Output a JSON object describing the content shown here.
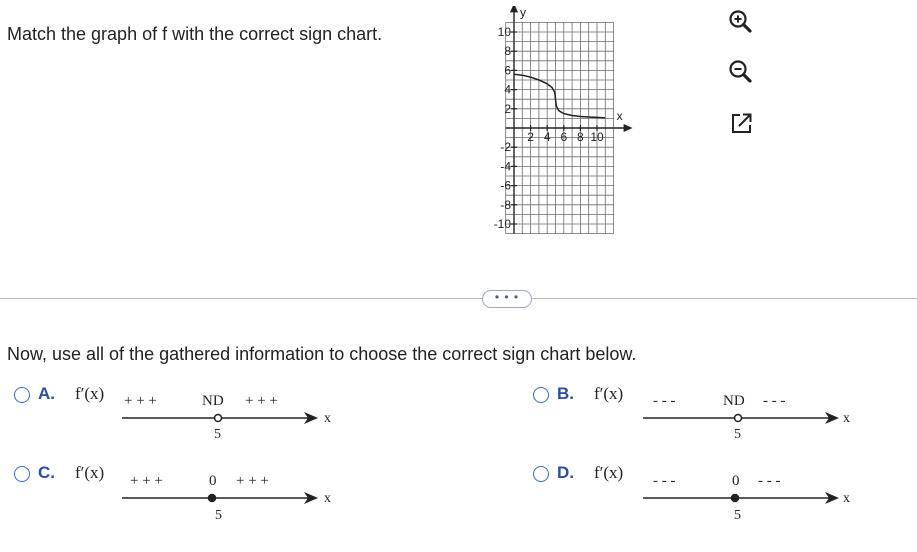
{
  "question": "Match the graph of f with the correct sign chart.",
  "graph": {
    "y_label": "y",
    "x_label": "x",
    "x_ticks": [
      "2",
      "4",
      "6",
      "8",
      "10"
    ],
    "y_ticks_pos": [
      "10",
      "8",
      "6",
      "4",
      "2"
    ],
    "y_ticks_neg": [
      "-2",
      "-4",
      "-6",
      "-8",
      "-10"
    ],
    "curve": [
      [
        0,
        5.6
      ],
      [
        1,
        5.5
      ],
      [
        2,
        5.3
      ],
      [
        3,
        5.0
      ],
      [
        4,
        4.6
      ],
      [
        4.6,
        4.2
      ],
      [
        4.9,
        3.7
      ],
      [
        5,
        3
      ],
      [
        5.1,
        2.3
      ],
      [
        5.4,
        1.8
      ],
      [
        6,
        1.5
      ],
      [
        7,
        1.3
      ],
      [
        8,
        1.2
      ],
      [
        9,
        1.15
      ],
      [
        10,
        1.1
      ],
      [
        11,
        1.05
      ]
    ]
  },
  "tools": {
    "zoom_in": "zoom-in-icon",
    "zoom_out": "zoom-out-icon",
    "new_window": "new-window-icon"
  },
  "more_button": "• • •",
  "prompt": "Now, use all of the gathered information to choose the correct sign chart below.",
  "options": [
    {
      "letter": "A.",
      "func": "f′(x)",
      "signs_left": "+ + +",
      "mid": "ND",
      "signs_right": "+ + +",
      "point": "5",
      "marker": "open",
      "var": "x"
    },
    {
      "letter": "B.",
      "func": "f′(x)",
      "signs_left": "- - -",
      "mid": "ND",
      "signs_right": "- - -",
      "point": "5",
      "marker": "open",
      "var": "x"
    },
    {
      "letter": "C.",
      "func": "f′(x)",
      "signs_left": "+ + +",
      "mid": "0",
      "signs_right": "+ + +",
      "point": "5",
      "marker": "closed",
      "var": "x"
    },
    {
      "letter": "D.",
      "func": "f′(x)",
      "signs_left": "- - -",
      "mid": "0",
      "signs_right": "- - -",
      "point": "5",
      "marker": "closed",
      "var": "x"
    }
  ]
}
